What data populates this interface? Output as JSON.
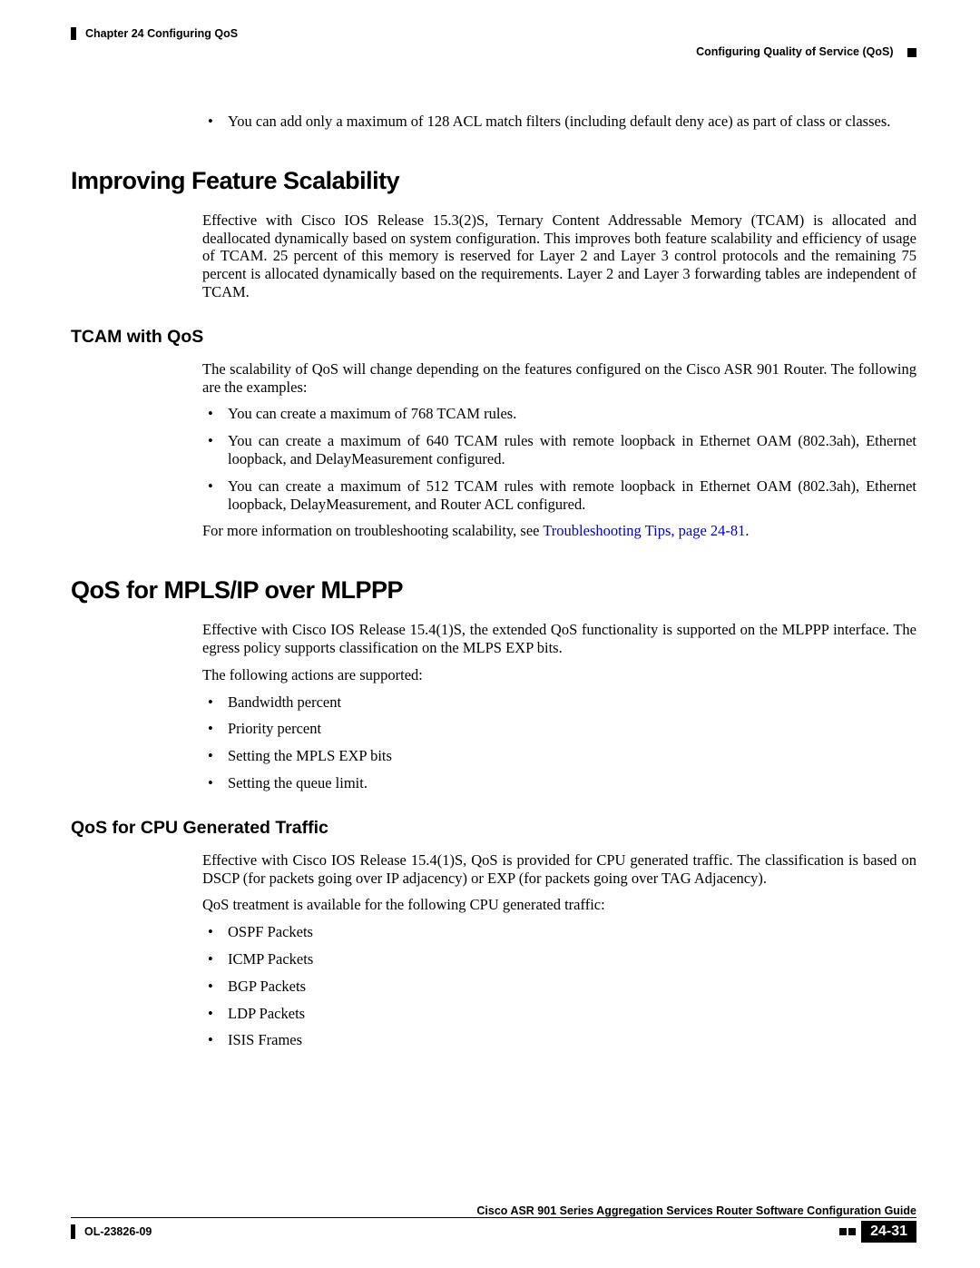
{
  "header": {
    "chapter": "Chapter 24    Configuring QoS",
    "section": "Configuring Quality of Service (QoS)"
  },
  "intro_bullet": "You can add only a maximum of 128 ACL match filters (including default deny ace) as part of class or classes.",
  "s1": {
    "title": "Improving Feature Scalability",
    "para": "Effective with Cisco IOS Release 15.3(2)S, Ternary Content Addressable Memory (TCAM) is allocated and deallocated dynamically based on system configuration. This improves both feature scalability and efficiency of usage of TCAM. 25 percent of this memory is reserved for Layer 2 and Layer 3 control protocols and the remaining 75 percent is allocated dynamically based on the requirements. Layer 2 and Layer 3 forwarding tables are independent of TCAM."
  },
  "s1a": {
    "title": "TCAM with QoS",
    "para1": "The scalability of QoS will change depending on the features configured on the Cisco ASR 901 Router. The following are the examples:",
    "b1": "You can create a maximum of 768 TCAM rules.",
    "b2": "You can create a maximum of 640 TCAM rules with remote loopback in Ethernet OAM (802.3ah), Ethernet loopback, and DelayMeasurement configured.",
    "b3": "You can create a maximum of 512 TCAM rules with remote loopback in Ethernet OAM (802.3ah), Ethernet loopback, DelayMeasurement, and Router ACL configured.",
    "para2_pre": "For more information on troubleshooting scalability, see ",
    "para2_link": "Troubleshooting Tips, page 24-81",
    "para2_post": "."
  },
  "s2": {
    "title": "QoS for MPLS/IP over MLPPP",
    "para1": "Effective with Cisco IOS Release 15.4(1)S, the extended QoS functionality is supported on the MLPPP interface. The egress policy supports classification on the MLPS EXP bits.",
    "para2": "The following actions are supported:",
    "b1": "Bandwidth percent",
    "b2": "Priority percent",
    "b3": "Setting the MPLS EXP bits",
    "b4": "Setting the queue limit."
  },
  "s2a": {
    "title": "QoS for CPU Generated Traffic",
    "para1": "Effective with Cisco IOS Release 15.4(1)S, QoS is provided for CPU generated traffic. The classification is based on DSCP (for packets going over IP adjacency) or EXP (for packets going over TAG Adjacency).",
    "para2": "QoS treatment is available for the following CPU generated traffic:",
    "b1": "OSPF Packets",
    "b2": "ICMP Packets",
    "b3": "BGP Packets",
    "b4": "LDP Packets",
    "b5": "ISIS Frames"
  },
  "footer": {
    "guide": "Cisco ASR 901 Series Aggregation Services Router Software Configuration Guide",
    "doc": "OL-23826-09",
    "page": "24-31"
  }
}
